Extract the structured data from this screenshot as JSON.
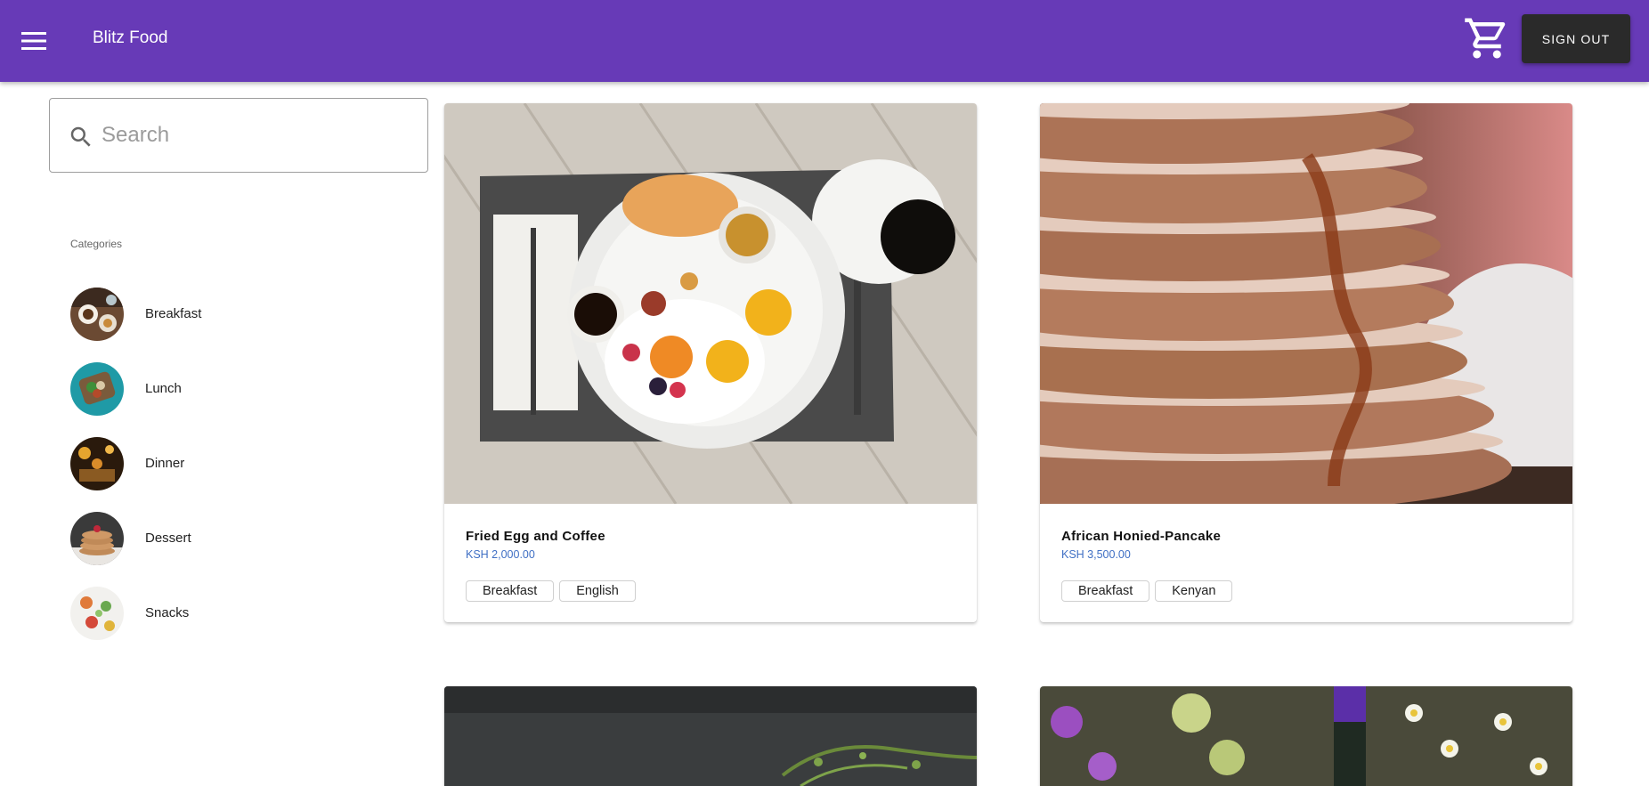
{
  "header": {
    "app_title": "Blitz Food",
    "menu_icon": "hamburger-menu-icon",
    "cart_icon": "shopping-cart-icon",
    "sign_out_label": "SIGN OUT",
    "background_color": "#673ab7"
  },
  "search": {
    "placeholder": "Search",
    "value": "",
    "icon": "search-icon"
  },
  "categories": {
    "heading": "Categories",
    "items": [
      {
        "label": "Breakfast"
      },
      {
        "label": "Lunch"
      },
      {
        "label": "Dinner"
      },
      {
        "label": "Dessert"
      },
      {
        "label": "Snacks"
      }
    ]
  },
  "products": [
    {
      "name": "Fried Egg and Coffee",
      "price": "KSH 2,000.00",
      "tags": [
        "Breakfast",
        "English"
      ]
    },
    {
      "name": "African Honied-Pancake",
      "price": "KSH 3,500.00",
      "tags": [
        "Breakfast",
        "Kenyan"
      ]
    }
  ],
  "colors": {
    "price": "#3f6fc4",
    "sign_out_button": "#2a2a2a"
  }
}
